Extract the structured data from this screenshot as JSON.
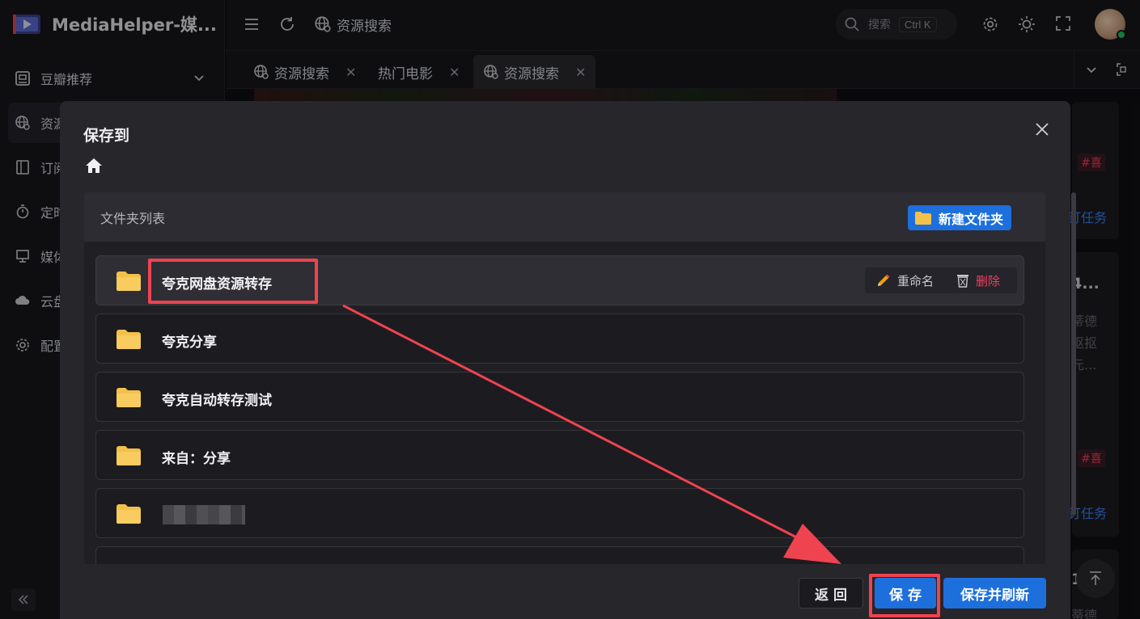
{
  "app": {
    "title": "MediaHelper-媒..."
  },
  "sidebar": {
    "items": [
      {
        "label": "豆瓣推荐",
        "icon": "douban-icon"
      },
      {
        "label": "资源搜索",
        "icon": "globe-search-icon"
      },
      {
        "label": "订阅",
        "icon": "subscribe-icon"
      },
      {
        "label": "定时",
        "icon": "timer-icon"
      },
      {
        "label": "媒体",
        "icon": "monitor-icon"
      },
      {
        "label": "云盘",
        "icon": "cloud-icon"
      },
      {
        "label": "配置",
        "icon": "gear-icon"
      }
    ]
  },
  "header": {
    "title": "资源搜索",
    "search_placeholder": "搜索",
    "search_shortcut": "Ctrl K"
  },
  "tabs": [
    {
      "label": "资源搜索",
      "active": false
    },
    {
      "label": "热门电影",
      "active": false
    },
    {
      "label": "资源搜索",
      "active": true
    }
  ],
  "background_peek": {
    "tag1": "#喜",
    "link1": "订任务",
    "bold1": "4...",
    "text1": "蒂德",
    "text2": "抠抠",
    "text3": "元...",
    "tag2": "#喜",
    "link2": "订任务",
    "bold2": "1",
    "text4": "蒂德"
  },
  "modal": {
    "title": "保存到",
    "panel_label": "文件夹列表",
    "new_folder_label": "新建文件夹",
    "rename_label": "重命名",
    "delete_label": "删除",
    "folders": [
      {
        "name": "夸克网盘资源转存"
      },
      {
        "name": "夸克分享"
      },
      {
        "name": "夸克自动转存测试"
      },
      {
        "name": "来自：分享"
      },
      {
        "name": ""
      }
    ],
    "back_label": "返 回",
    "save_label": "保 存",
    "save_refresh_label": "保存并刷新"
  },
  "colors": {
    "accent": "#1d6fdc",
    "danger": "#f43f5e",
    "annotation": "#ef4350",
    "folder": "#f5c04a"
  }
}
